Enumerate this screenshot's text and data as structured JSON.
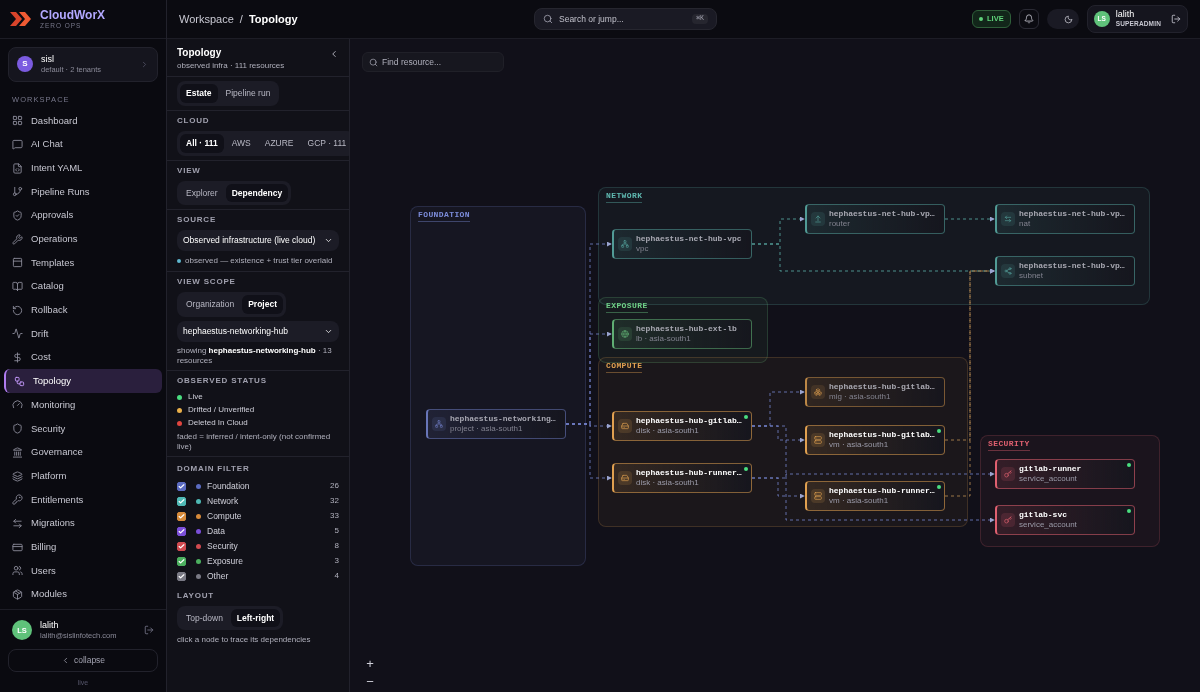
{
  "brand": {
    "name": "CloudWorX",
    "tagline": "ZERO OPS"
  },
  "tenant": {
    "initial": "S",
    "name": "sisl",
    "detail": "default · 2 tenants"
  },
  "nav_section": "WORKSPACE",
  "nav": [
    {
      "label": "Dashboard",
      "selected": false
    },
    {
      "label": "AI Chat",
      "selected": false
    },
    {
      "label": "Intent YAML",
      "selected": false
    },
    {
      "label": "Pipeline Runs",
      "selected": false
    },
    {
      "label": "Approvals",
      "selected": false
    },
    {
      "label": "Operations",
      "selected": false
    },
    {
      "label": "Templates",
      "selected": false
    },
    {
      "label": "Catalog",
      "selected": false
    },
    {
      "label": "Rollback",
      "selected": false
    },
    {
      "label": "Drift",
      "selected": false
    },
    {
      "label": "Cost",
      "selected": false
    },
    {
      "label": "Topology",
      "selected": true
    },
    {
      "label": "Monitoring",
      "selected": false
    },
    {
      "label": "Security",
      "selected": false
    },
    {
      "label": "Governance",
      "selected": false
    },
    {
      "label": "Platform",
      "selected": false
    },
    {
      "label": "Entitlements",
      "selected": false
    },
    {
      "label": "Migrations",
      "selected": false
    },
    {
      "label": "Billing",
      "selected": false
    },
    {
      "label": "Users",
      "selected": false
    },
    {
      "label": "Modules",
      "selected": false
    }
  ],
  "user": {
    "initials": "LS",
    "name": "lalith",
    "email": "lalith@sislinfotech.com"
  },
  "collapse": "collapse",
  "build": "live",
  "breadcrumb": {
    "parent": "Workspace",
    "separator": "/",
    "current": "Topology"
  },
  "search": {
    "placeholder": "Search or jump...",
    "shortcut": "⌘K"
  },
  "live_badge": "LIVE",
  "dark_mode": true,
  "header_user": {
    "initials": "LS",
    "name": "lalith",
    "role": "SUPERADMIN"
  },
  "panel": {
    "title": "Topology",
    "subtitle": "observed infra · 111 resources",
    "mode_tabs": [
      {
        "label": "Estate",
        "selected": true
      },
      {
        "label": "Pipeline run",
        "selected": false
      }
    ],
    "cloud": {
      "label": "CLOUD",
      "options": [
        {
          "label": "All · 111",
          "selected": true
        },
        {
          "label": "AWS",
          "selected": false
        },
        {
          "label": "AZURE",
          "selected": false
        },
        {
          "label": "GCP · 111",
          "selected": false
        }
      ]
    },
    "view": {
      "label": "VIEW",
      "options": [
        {
          "label": "Explorer",
          "selected": false
        },
        {
          "label": "Dependency",
          "selected": true
        }
      ]
    },
    "source": {
      "label": "SOURCE",
      "value": "Observed infrastructure (live cloud)",
      "note": "observed — existence + trust tier overlaid"
    },
    "scope": {
      "label": "VIEW SCOPE",
      "options": [
        {
          "label": "Organization",
          "selected": false
        },
        {
          "label": "Project",
          "selected": true
        }
      ],
      "project": "hephaestus-networking-hub",
      "showing": "showing **hephaestus-networking-hub** · 13 resources"
    },
    "status": {
      "label": "OBSERVED STATUS",
      "items": [
        {
          "label": "Live",
          "color": "#4ade80"
        },
        {
          "label": "Drifted / Unverified",
          "color": "#eab04a"
        },
        {
          "label": "Deleted In Cloud",
          "color": "#e0453f"
        }
      ],
      "note": "faded = inferred / intent-only (not confirmed live)"
    },
    "domain_filter": {
      "label": "DOMAIN FILTER",
      "items": [
        {
          "label": "Foundation",
          "color": "#5b6bc0",
          "checked": true,
          "count": "26"
        },
        {
          "label": "Network",
          "color": "#4fb8b4",
          "checked": true,
          "count": "32"
        },
        {
          "label": "Compute",
          "color": "#d68a3a",
          "checked": true,
          "count": "33"
        },
        {
          "label": "Data",
          "color": "#7b4fd8",
          "checked": true,
          "count": "5"
        },
        {
          "label": "Security",
          "color": "#d04a50",
          "checked": true,
          "count": "8"
        },
        {
          "label": "Exposure",
          "color": "#4caf5f",
          "checked": true,
          "count": "3"
        },
        {
          "label": "Other",
          "color": "#7a7a85",
          "checked": true,
          "count": "4"
        }
      ]
    },
    "layout": {
      "label": "LAYOUT",
      "options": [
        {
          "label": "Top-down",
          "selected": false
        },
        {
          "label": "Left-right",
          "selected": true
        }
      ],
      "hint": "click a node to trace its dependencies"
    }
  },
  "canvas": {
    "find_placeholder": "Find resource...",
    "groups": [
      {
        "label": "FOUNDATION",
        "color": "#7b8bd9",
        "nodes": [
          {
            "name": "hephaestus-networking…",
            "meta": "project · asia-south1",
            "live": false
          }
        ]
      },
      {
        "label": "NETWORK",
        "color": "#5fb8b0",
        "nodes": [
          {
            "name": "hephaestus-net-hub-vpc",
            "meta": "vpc",
            "live": false
          },
          {
            "name": "hephaestus-net-hub-vp…",
            "meta": "router",
            "live": false
          },
          {
            "name": "hephaestus-net-hub-vp…",
            "meta": "nat",
            "live": false
          },
          {
            "name": "hephaestus-net-hub-vp…",
            "meta": "subnet",
            "live": false
          }
        ]
      },
      {
        "label": "EXPOSURE",
        "color": "#6fcf86",
        "nodes": [
          {
            "name": "hephaestus-hub-ext-lb",
            "meta": "lb · asia-south1",
            "live": false
          }
        ]
      },
      {
        "label": "COMPUTE",
        "color": "#e0a050",
        "nodes": [
          {
            "name": "hephaestus-hub-gitlab…",
            "meta": "mig · asia-south1",
            "live": false
          },
          {
            "name": "hephaestus-hub-gitlab…",
            "meta": "disk · asia-south1",
            "live": true
          },
          {
            "name": "hephaestus-hub-gitlab…",
            "meta": "vm · asia-south1",
            "live": true
          },
          {
            "name": "hephaestus-hub-runner…",
            "meta": "disk · asia-south1",
            "live": true
          },
          {
            "name": "hephaestus-hub-runner…",
            "meta": "vm · asia-south1",
            "live": true
          }
        ]
      },
      {
        "label": "SECURITY",
        "color": "#e06070",
        "nodes": [
          {
            "name": "gitlab-runner",
            "meta": "service_account",
            "live": true
          },
          {
            "name": "gitlab-svc",
            "meta": "service_account",
            "live": true
          }
        ]
      }
    ],
    "zoom_in": "+",
    "zoom_out": "−"
  }
}
